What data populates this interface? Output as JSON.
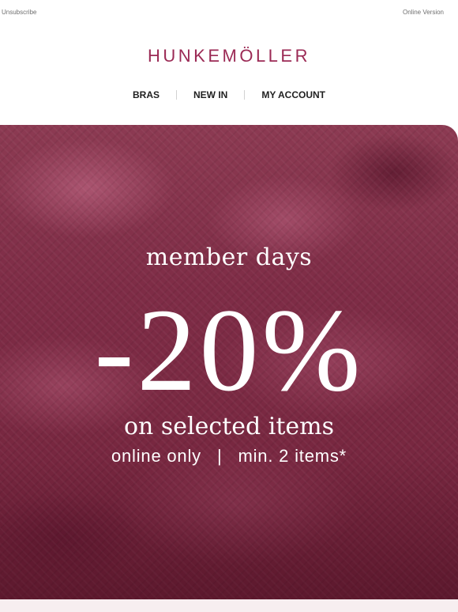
{
  "topbar": {
    "unsubscribe": "Unsubscribe",
    "online_version": "Online Version"
  },
  "logo": {
    "text": "HUNKEMÖLLER"
  },
  "nav": {
    "items": [
      {
        "label": "BRAS"
      },
      {
        "label": "NEW IN"
      },
      {
        "label": "MY ACCOUNT"
      }
    ]
  },
  "hero": {
    "headline": "member days",
    "discount": "-20%",
    "subline": "on selected items",
    "terms_left": "online only",
    "terms_separator": "|",
    "terms_right": "min. 2 items*"
  },
  "colors": {
    "brand": "#9b2a55",
    "hero_background": "#7e2c46",
    "nav_text": "#1f1f1f"
  }
}
